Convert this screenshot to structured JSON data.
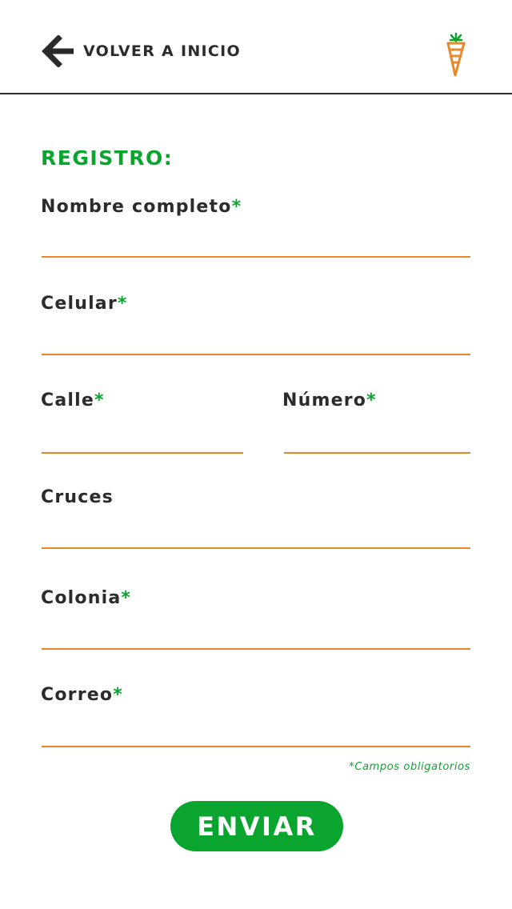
{
  "header": {
    "back_label": "VOLVER A INICIO",
    "back_icon": "arrow-left-icon",
    "logo_icon": "carrot-icon"
  },
  "form": {
    "title": "REGISTRO:",
    "required_marker": "*",
    "fields": {
      "nombre": {
        "label": "Nombre completo",
        "value": "",
        "required": true
      },
      "celular": {
        "label": "Celular",
        "value": "",
        "required": true
      },
      "calle": {
        "label": "Calle",
        "value": "",
        "required": true
      },
      "numero": {
        "label": "Número",
        "value": "",
        "required": true
      },
      "cruces": {
        "label": "Cruces",
        "value": "",
        "required": false
      },
      "colonia": {
        "label": "Colonia",
        "value": "",
        "required": true
      },
      "correo": {
        "label": "Correo",
        "value": "",
        "required": true
      }
    },
    "required_note": "*Campos obligatorios",
    "submit_label": "ENVIAR"
  },
  "colors": {
    "accent_green": "#0aa52e",
    "underline_orange": "#e8882a",
    "text_dark": "#2b2b2b",
    "background": "#ffffff"
  }
}
